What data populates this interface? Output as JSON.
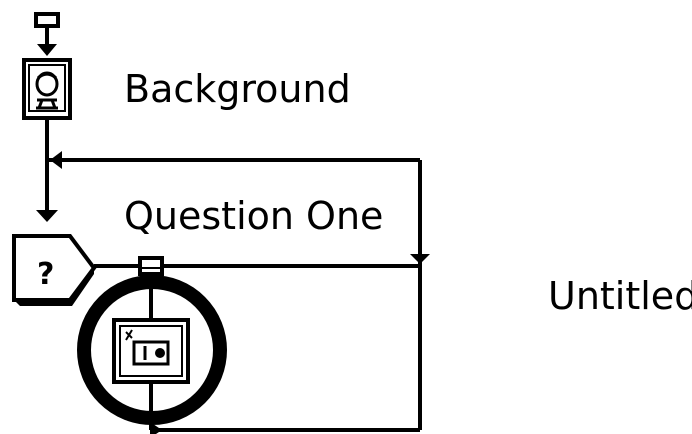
{
  "flowchart": {
    "nodes": {
      "background": {
        "label": "Background",
        "icon": "display-icon"
      },
      "question": {
        "label": "Question One",
        "icon": "decision-icon",
        "glyph": "?"
      },
      "untitled": {
        "label": "Untitled",
        "icon": "interaction-icon"
      }
    }
  },
  "colors": {
    "line": "#000000",
    "background": "#ffffff"
  }
}
